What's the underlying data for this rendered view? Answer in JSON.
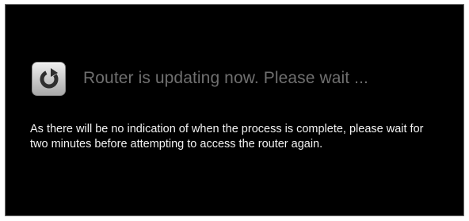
{
  "dialog": {
    "icon": "update-refresh-icon",
    "headline": "Router is updating now. Please wait ...",
    "message": "As there will be no indication of when the process is complete, please wait for two minutes before attempting to access the router again."
  },
  "colors": {
    "background": "#000000",
    "headline": "#6f6f6f",
    "message": "#f2f2f2",
    "icon_tile": "#cfcfcf",
    "icon_glyph": "#2f2f2f"
  }
}
